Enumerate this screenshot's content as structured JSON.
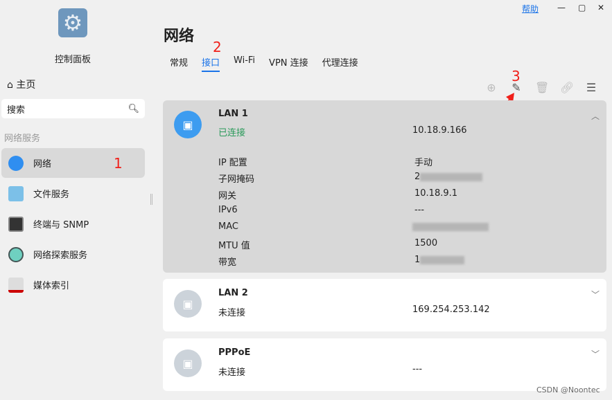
{
  "app": {
    "title": "控制面板",
    "help": "帮助"
  },
  "sidebar": {
    "home": "主页",
    "search_placeholder": "搜索",
    "section": "网络服务",
    "items": [
      {
        "label": "网络"
      },
      {
        "label": "文件服务"
      },
      {
        "label": "终端与 SNMP"
      },
      {
        "label": "网络探索服务"
      },
      {
        "label": "媒体索引"
      }
    ]
  },
  "page": {
    "title": "网络",
    "tabs": [
      "常规",
      "接口",
      "Wi-Fi",
      "VPN 连接",
      "代理连接"
    ]
  },
  "annotations": [
    "1",
    "2",
    "3"
  ],
  "interfaces": [
    {
      "name": "LAN 1",
      "status": "已连接",
      "ip": "10.18.9.166",
      "details": [
        {
          "k": "IP 配置",
          "v": "手动"
        },
        {
          "k": "子网掩码",
          "v": "2"
        },
        {
          "k": "网关",
          "v": "10.18.9.1"
        },
        {
          "k": "IPv6",
          "v": "---"
        },
        {
          "k": "MAC",
          "v": ""
        },
        {
          "k": "MTU 值",
          "v": "1500"
        },
        {
          "k": "带宽",
          "v": "1"
        }
      ]
    },
    {
      "name": "LAN 2",
      "status": "未连接",
      "ip": "169.254.253.142"
    },
    {
      "name": "PPPoE",
      "status": "未连接",
      "ip": "---"
    }
  ],
  "watermark": "CSDN @Noontec"
}
